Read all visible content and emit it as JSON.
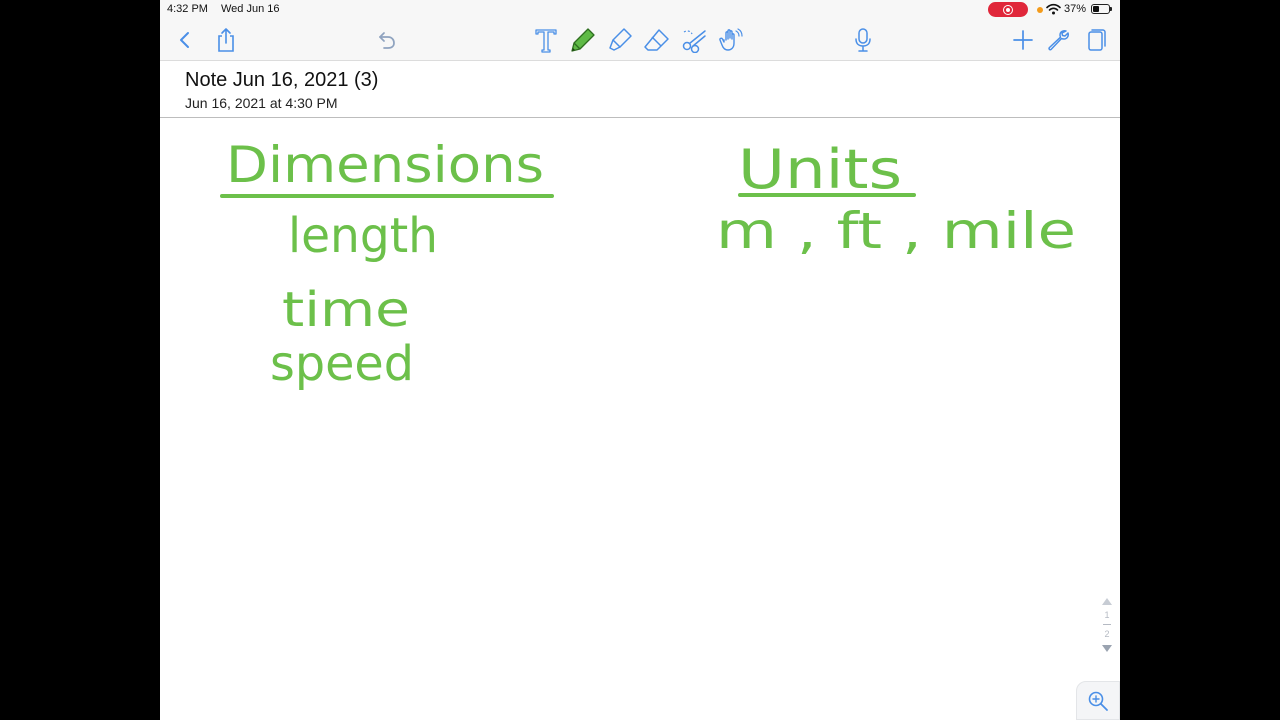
{
  "status_bar": {
    "time": "4:32 PM",
    "date": "Wed Jun 16",
    "battery_percent": "37%",
    "battery_level": 0.37,
    "icons": [
      "screen-record-icon",
      "mic-in-use-icon",
      "wifi-icon",
      "battery-icon"
    ]
  },
  "toolbar": {
    "left_icons": [
      "back-chevron-icon",
      "share-icon",
      "undo-icon"
    ],
    "tools": [
      "text-tool-icon",
      "pen-tool-icon",
      "highlighter-tool-icon",
      "eraser-tool-icon",
      "lasso-scissors-icon",
      "hand-gesture-icon",
      "microphone-icon"
    ],
    "active_tool": "pen",
    "right_icons": [
      "add-icon",
      "settings-wrench-icon",
      "pages-icon"
    ],
    "accent_color": "#4a8fe7",
    "pen_color": "#5fba46"
  },
  "note": {
    "title": "Note Jun 16, 2021 (3)",
    "subtitle": "Jun 16, 2021 at 4:30 PM"
  },
  "handwriting": {
    "ink_color": "#6cc04a",
    "left_heading": "Dimensions",
    "left_items": [
      "length",
      "time",
      "speed"
    ],
    "right_heading": "Units",
    "right_items": "m , ft , mile"
  },
  "page_indicator": {
    "current": "1",
    "total": "2"
  },
  "zoom": {
    "icon": "zoom-in-magnifier-icon"
  }
}
